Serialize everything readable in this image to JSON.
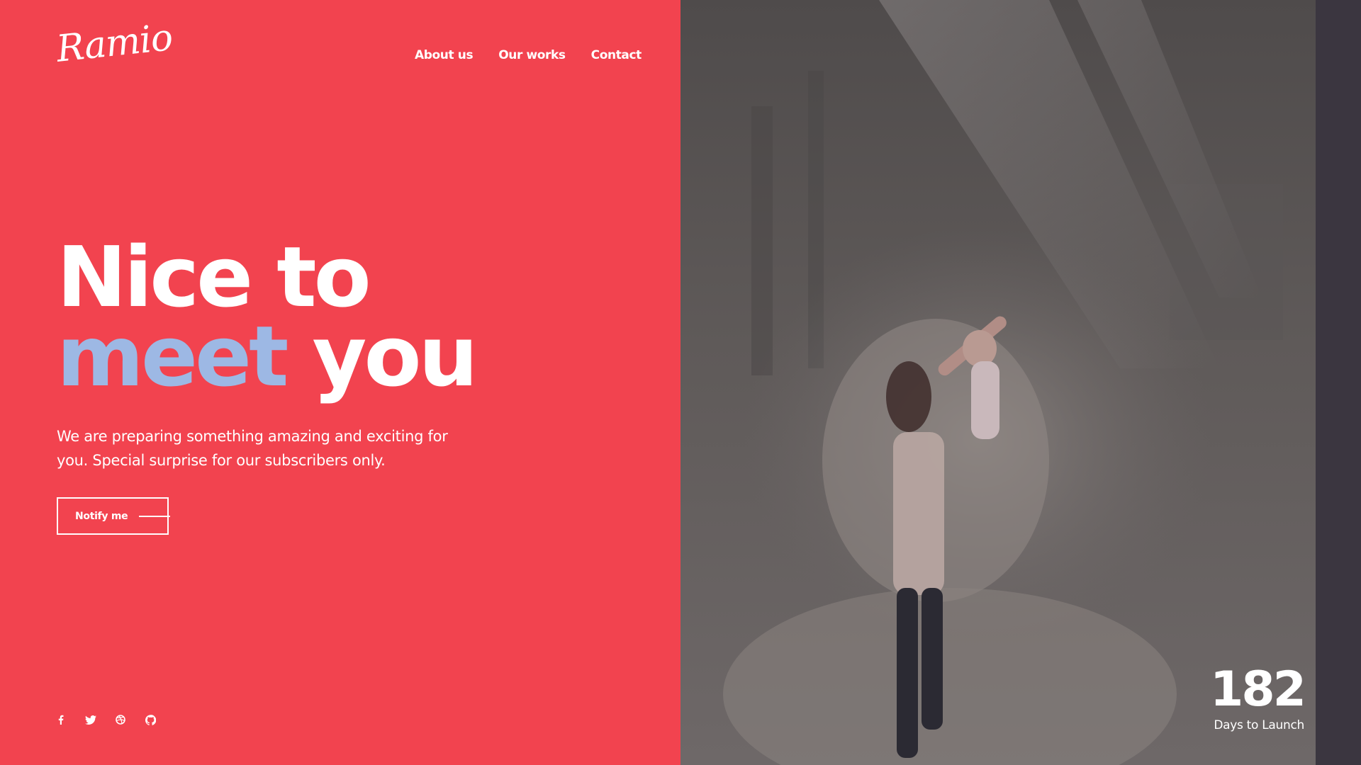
{
  "brand": {
    "logo_text": "Ramio"
  },
  "nav": {
    "items": [
      {
        "label": "About us"
      },
      {
        "label": "Our works"
      },
      {
        "label": "Contact"
      }
    ]
  },
  "hero": {
    "headline_line1": "Nice to",
    "headline_accent": "meet",
    "headline_rest": " you",
    "subtitle": "We are preparing something amazing and exciting for you. Special surprise for our subscribers only.",
    "cta_label": "Notify me"
  },
  "social": {
    "icons": [
      "facebook-icon",
      "twitter-icon",
      "dribbble-icon",
      "github-icon"
    ]
  },
  "countdown": {
    "value": "182",
    "label": "Days to Launch"
  },
  "colors": {
    "primary": "#F2434F",
    "accent": "#9DB8E4",
    "text": "#FFFFFF",
    "overlay": "#5A5656"
  }
}
